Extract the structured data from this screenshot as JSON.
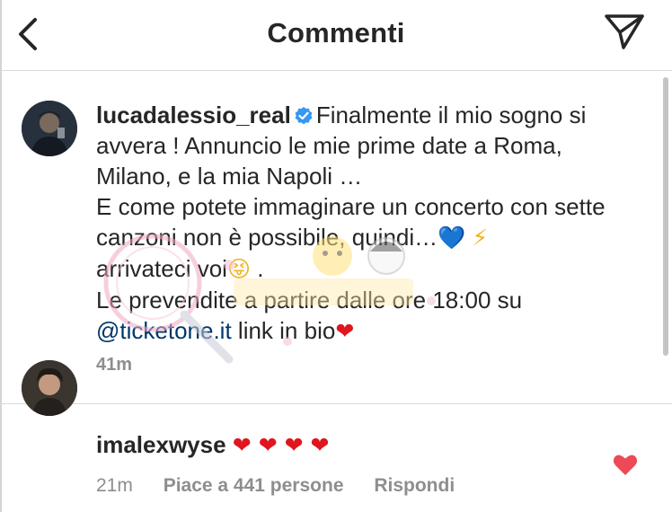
{
  "header": {
    "title": "Commenti",
    "back_icon": "chevron-left-icon",
    "share_icon": "paper-plane-icon"
  },
  "caption": {
    "username": "lucadalessio_real",
    "verified_icon": "verified-badge-icon",
    "line1": "Finalmente il mio sogno si avvera ! Annuncio le mie prime date a Roma, Milano, e la mia Napoli …",
    "line2": "E come potete immaginare un concerto con sette canzoni non è possibile, quindi…",
    "emoji_blue_heart": "💙",
    "emoji_bolt": "⚡",
    "line3": "arrivateci voi",
    "emoji_face": "😝",
    "line3_end": ".",
    "line4": "Le prevendite a partire dalle ore 18:00 su",
    "mention": "@ticketone.it",
    "line5": " link in bio",
    "emoji_red_heart": "❤",
    "time": "41m"
  },
  "comment": {
    "username": "imalexwyse",
    "text": "❤ ❤ ❤ ❤",
    "time": "21m",
    "likes": "Piace a 441 persone",
    "reply": "Rispondi",
    "like_icon": "heart-icon",
    "like_color": "#ed4956"
  },
  "colors": {
    "text": "#262626",
    "secondary": "#8e8e8e",
    "link": "#00376b",
    "verified": "#3897f0"
  }
}
